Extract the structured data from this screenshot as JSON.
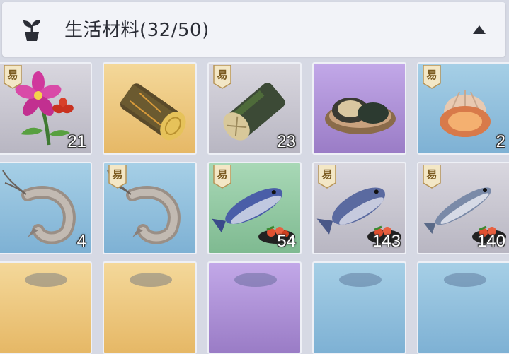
{
  "header": {
    "title": "生活材料(32/50)",
    "icon": "sprout-pot-icon",
    "toggle_icon": "collapse-up-icon"
  },
  "badge_text": "易",
  "items": [
    {
      "name": "flower",
      "bg": "gray",
      "qty": "21",
      "badge": true
    },
    {
      "name": "golden-log",
      "bg": "gold",
      "qty": "",
      "badge": false
    },
    {
      "name": "mossy-log",
      "bg": "gray",
      "qty": "23",
      "badge": true
    },
    {
      "name": "abalone",
      "bg": "purple",
      "qty": "",
      "badge": false
    },
    {
      "name": "scallop",
      "bg": "blue",
      "qty": "2",
      "badge": true
    },
    {
      "name": "shrimp",
      "bg": "blue",
      "qty": "4",
      "badge": false
    },
    {
      "name": "shrimp",
      "bg": "blue",
      "qty": "",
      "badge": true
    },
    {
      "name": "salmon",
      "bg": "green",
      "qty": "54",
      "badge": true
    },
    {
      "name": "sea-bream",
      "bg": "gray",
      "qty": "143",
      "badge": true
    },
    {
      "name": "sardine",
      "bg": "gray",
      "qty": "140",
      "badge": true
    },
    {
      "name": "partial-item",
      "bg": "gold",
      "qty": "",
      "badge": false
    },
    {
      "name": "partial-item",
      "bg": "gold",
      "qty": "",
      "badge": false
    },
    {
      "name": "partial-item",
      "bg": "purple",
      "qty": "",
      "badge": false
    },
    {
      "name": "partial-item",
      "bg": "blue",
      "qty": "",
      "badge": false
    },
    {
      "name": "partial-item",
      "bg": "blue",
      "qty": "",
      "badge": false
    }
  ],
  "colors": {
    "header_bg": "#f2f3f8",
    "page_bg": "#d6d9e4",
    "qty_text": "#ffffff"
  }
}
